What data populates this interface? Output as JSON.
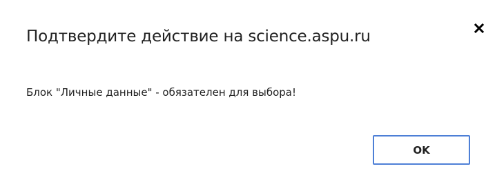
{
  "dialog": {
    "title": "Подтвердите действие на science.aspu.ru",
    "message": "Блок \"Личные данные\" - обязателен для выбора!",
    "ok_label": "OK",
    "close_icon": "close-icon"
  },
  "colors": {
    "button_border": "#4d7fd6",
    "text": "#222222",
    "background": "#ffffff"
  }
}
